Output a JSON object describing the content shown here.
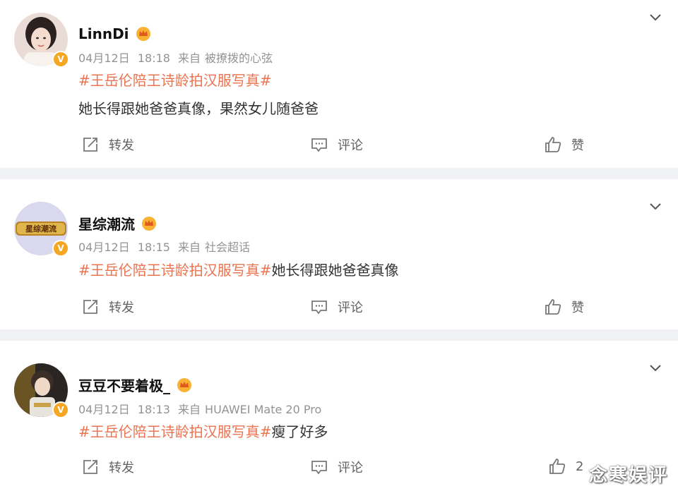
{
  "posts": [
    {
      "user": "LinnDi",
      "date": "04月12日",
      "time": "18:18",
      "source_prefix": "来自",
      "source": "被撩拨的心弦",
      "topic": "#王岳伦陪王诗龄拍汉服写真#",
      "text": "她长得跟她爸爸真像，果然女儿随爸爸",
      "repost_label": "转发",
      "comment_label": "评论",
      "like_label": "赞"
    },
    {
      "user": "星综潮流",
      "date": "04月12日",
      "time": "18:15",
      "source_prefix": "来自",
      "source": "社会超话",
      "topic": "#王岳伦陪王诗龄拍汉服写真#",
      "text": "她长得跟她爸爸真像",
      "repost_label": "转发",
      "comment_label": "评论",
      "like_label": "赞",
      "avatar_text": "星综潮流"
    },
    {
      "user": "豆豆不要着极_",
      "date": "04月12日",
      "time": "18:13",
      "source_prefix": "来自",
      "source": "HUAWEI Mate 20 Pro",
      "topic": "#王岳伦陪王诗龄拍汉服写真#",
      "text": "瘦了好多",
      "repost_label": "转发",
      "comment_label": "评论",
      "like_label": "2"
    }
  ],
  "watermark": "念寒娱评",
  "colors": {
    "topic": "#eb7350",
    "meta": "#939393",
    "badge": "#f5a623",
    "background": "#f1f2f5"
  },
  "icons": [
    "verified-badge-icon",
    "crown-icon",
    "chevron-down-icon",
    "repost-icon",
    "comment-icon",
    "like-icon"
  ]
}
